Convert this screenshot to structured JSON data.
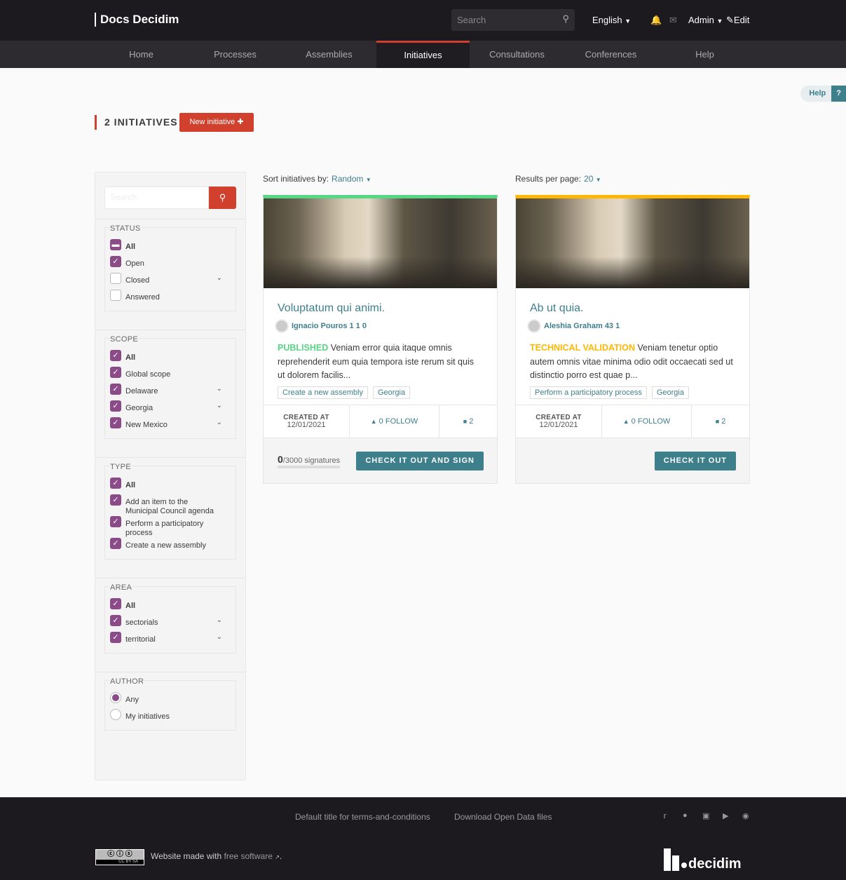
{
  "header": {
    "site_title": "Docs Decidim",
    "search_placeholder": "Search",
    "language": "English",
    "user": "Admin",
    "edit": "Edit"
  },
  "nav": [
    {
      "label": "Home"
    },
    {
      "label": "Processes"
    },
    {
      "label": "Assemblies"
    },
    {
      "label": "Initiatives",
      "active": true
    },
    {
      "label": "Consultations"
    },
    {
      "label": "Conferences"
    },
    {
      "label": "Help"
    }
  ],
  "help_tab": {
    "label": "Help",
    "icon": "?"
  },
  "page": {
    "title": "2 INITIATIVES",
    "new_button": "New initiative"
  },
  "filters": {
    "search_placeholder": "Search",
    "groups": [
      {
        "legend": "STATUS",
        "type": "checkbox",
        "items": [
          {
            "label": "All",
            "state": "indeterminate",
            "bold": true
          },
          {
            "label": "Open",
            "state": "checked"
          },
          {
            "label": "Closed",
            "state": "unchecked",
            "expandable": true
          },
          {
            "label": "Answered",
            "state": "unchecked"
          }
        ]
      },
      {
        "legend": "SCOPE",
        "type": "checkbox",
        "items": [
          {
            "label": "All",
            "state": "checked",
            "bold": true
          },
          {
            "label": "Global scope",
            "state": "checked"
          },
          {
            "label": "Delaware",
            "state": "checked",
            "expandable": true
          },
          {
            "label": "Georgia",
            "state": "checked",
            "expandable": true
          },
          {
            "label": "New Mexico",
            "state": "checked",
            "expandable": true
          }
        ]
      },
      {
        "legend": "TYPE",
        "type": "checkbox",
        "items": [
          {
            "label": "All",
            "state": "checked",
            "bold": true
          },
          {
            "label": "Add an item to the Municipal Council agenda",
            "state": "checked"
          },
          {
            "label": "Perform a participatory process",
            "state": "checked"
          },
          {
            "label": "Create a new assembly",
            "state": "checked"
          }
        ]
      },
      {
        "legend": "AREA",
        "type": "checkbox",
        "items": [
          {
            "label": "All",
            "state": "checked",
            "bold": true
          },
          {
            "label": "sectorials",
            "state": "checked",
            "expandable": true
          },
          {
            "label": "territorial",
            "state": "checked",
            "expandable": true
          }
        ]
      },
      {
        "legend": "AUTHOR",
        "type": "radio",
        "items": [
          {
            "label": "Any",
            "state": "checked"
          },
          {
            "label": "My initiatives",
            "state": "unchecked"
          }
        ]
      }
    ]
  },
  "sort": {
    "label": "Sort initiatives by:",
    "value": "Random"
  },
  "per_page": {
    "label": "Results per page:",
    "value": "20"
  },
  "cards": [
    {
      "title": "Voluptatum qui animi.",
      "author": "Ignacio Pouros 1 1 0",
      "status": "PUBLISHED",
      "status_color": "#57d685",
      "description": "Veniam error quia itaque omnis reprehenderit eum quia tempora iste rerum sit quis ut dolorem facilis...",
      "tags": [
        "Create a new assembly",
        "Georgia"
      ],
      "created_label": "CREATED AT",
      "created": "12/01/2021",
      "follow": "0 FOLLOW",
      "comments": "2",
      "signatures": "0",
      "signatures_total": "/3000 signatures",
      "signature_progress": 0,
      "button": "CHECK IT OUT AND SIGN"
    },
    {
      "title": "Ab ut quia.",
      "author": "Aleshia Graham 43 1",
      "status": "TECHNICAL VALIDATION",
      "status_color": "#ffb703",
      "description": "Veniam tenetur optio autem omnis vitae minima odio odit occaecati sed ut distinctio porro est quae p...",
      "tags": [
        "Perform a participatory process",
        "Georgia"
      ],
      "created_label": "CREATED AT",
      "created": "12/01/2021",
      "follow": "0 FOLLOW",
      "comments": "2",
      "button": "CHECK IT OUT"
    }
  ],
  "footer": {
    "links": [
      "Default title for terms-and-conditions",
      "Download Open Data files"
    ],
    "social": [
      "twitter-icon",
      "facebook-icon",
      "instagram-icon",
      "youtube-icon",
      "github-icon"
    ],
    "made_with": "Website made with",
    "free_software": "free software",
    "logo": "decidim",
    "license": "CC BY SA"
  }
}
